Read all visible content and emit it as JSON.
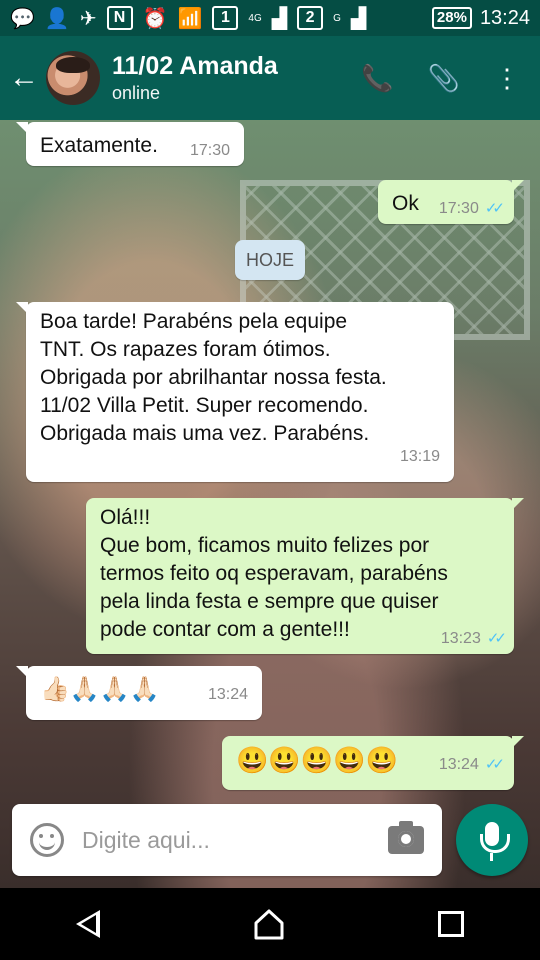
{
  "status_bar": {
    "sim1": "1",
    "sim1_network": "4G",
    "sim2": "2",
    "sim2_network": "G",
    "battery": "28%",
    "time": "13:24"
  },
  "header": {
    "contact_name": "11/02 Amanda",
    "status": "online",
    "icons": [
      "back-arrow-icon",
      "phone-icon",
      "paperclip-icon",
      "more-vert-icon"
    ]
  },
  "messages": [
    {
      "dir": "in",
      "text": "Exatamente.",
      "time": "17:30"
    },
    {
      "dir": "out",
      "text": "Ok",
      "time": "17:30",
      "read": true
    },
    {
      "dir": "in",
      "text": "Boa tarde! Parabéns pela equipe\nTNT. Os rapazes foram ótimos.\nObrigada por abrilhantar nossa festa.\n11/02 Villa Petit. Super recomendo.\nObrigada mais uma vez. Parabéns.",
      "time": "13:19"
    },
    {
      "dir": "out",
      "text": "Olá!!!\nQue bom, ficamos muito felizes por\ntermos feito oq esperavam, parabéns\npela linda festa e sempre que quiser\npode contar com a gente!!!",
      "time": "13:23",
      "read": true
    },
    {
      "dir": "in",
      "text": "👍🏻🙏🏻🙏🏻🙏🏻",
      "time": "13:24"
    },
    {
      "dir": "out",
      "text": "😃😃😃😃😃",
      "time": "13:24",
      "read": true
    }
  ],
  "date_divider": "HOJE",
  "composer": {
    "placeholder": "Digite aqui..."
  },
  "colors": {
    "app_bar": "#075e54",
    "status_bar": "#054d44",
    "outgoing_bubble": "#dcf8c6",
    "incoming_bubble": "#ffffff",
    "mic_button": "#008a76",
    "read_ticks": "#4fc3f7"
  }
}
